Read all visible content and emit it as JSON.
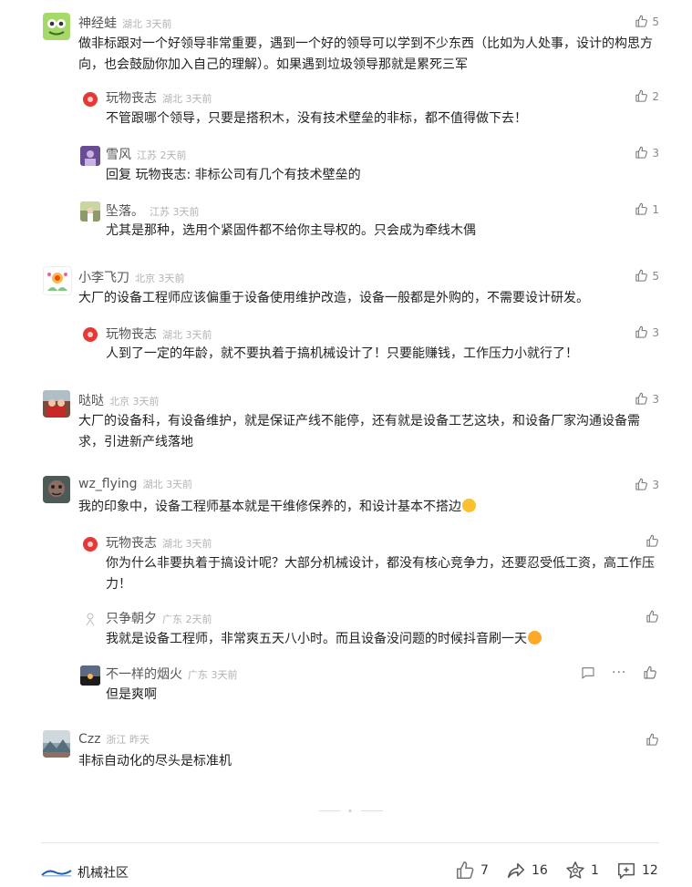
{
  "comments": [
    {
      "user": "神经蛙",
      "location": "湖北",
      "time": "3天前",
      "likes": "5",
      "text": "做非标跟对一个好领导非常重要，遇到一个好的领导可以学到不少东西（比如为人处事，设计的构思方向，也会鼓励你加入自己的理解）。如果遇到垃圾领导那就是累死三军"
    },
    {
      "user": "玩物丧志",
      "location": "湖北",
      "time": "3天前",
      "likes": "2",
      "text": "不管跟哪个领导，只要是搭积木，没有技术壁垒的非标，都不值得做下去！"
    },
    {
      "user": "雪风",
      "location": "江苏",
      "time": "2天前",
      "likes": "3",
      "text": "回复 玩物丧志: 非标公司有几个有技术壁垒的"
    },
    {
      "user": "坠落。",
      "location": "江苏",
      "time": "3天前",
      "likes": "1",
      "text": "尤其是那种，选用个紧固件都不给你主导权的。只会成为牵线木偶"
    },
    {
      "user": "小李飞刀",
      "location": "北京",
      "time": "3天前",
      "likes": "5",
      "text": "大厂的设备工程师应该偏重于设备使用维护改造，设备一般都是外购的，不需要设计研发。"
    },
    {
      "user": "玩物丧志",
      "location": "湖北",
      "time": "3天前",
      "likes": "3",
      "text": "人到了一定的年龄，就不要执着于搞机械设计了！只要能赚钱，工作压力小就行了！"
    },
    {
      "user": "哒哒",
      "location": "北京",
      "time": "3天前",
      "likes": "3",
      "text": "大厂的设备科，有设备维护，就是保证产线不能停，还有就是设备工艺这块，和设备厂家沟通设备需求，引进新产线落地"
    },
    {
      "user": "wz_flying",
      "location": "湖北",
      "time": "3天前",
      "likes": "3",
      "text": "我的印象中，设备工程师基本就是干维修保养的，和设计基本不搭边"
    },
    {
      "user": "玩物丧志",
      "location": "湖北",
      "time": "3天前",
      "likes": "",
      "text": "你为什么非要执着于搞设计呢？大部分机械设计，都没有核心竞争力，还要忍受低工资，高工作压力！"
    },
    {
      "user": "只争朝夕",
      "location": "广东",
      "time": "2天前",
      "likes": "",
      "text": "我就是设备工程师，非常爽五天八小时。而且设备没问题的时候抖音刷一天"
    },
    {
      "user": "不一样的烟火",
      "location": "广东",
      "time": "3天前",
      "likes": "",
      "text": "但是爽啊"
    },
    {
      "user": "Czz",
      "location": "浙江",
      "time": "昨天",
      "likes": "",
      "text": "非标自动化的尽头是标准机"
    }
  ],
  "footer": {
    "community": "机械社区",
    "likes": "7",
    "shares": "16",
    "favorites": "1",
    "comments": "12"
  },
  "icons": {
    "like": "thumbs-up-icon",
    "reply": "comment-bubble-icon",
    "more": "more-dots-icon",
    "share": "share-arrow-icon",
    "favorite": "favorite-star-icon",
    "comment": "comment-add-icon"
  },
  "colors": {
    "text": "#222222",
    "meta": "#b3b3b3",
    "name": "#555555",
    "icon": "#888888"
  }
}
